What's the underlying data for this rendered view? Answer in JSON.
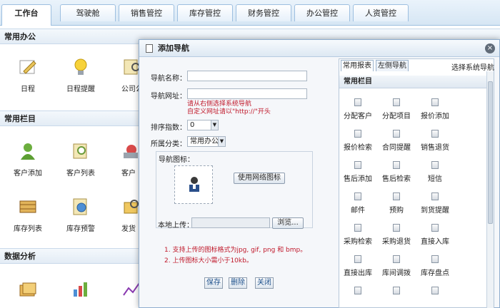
{
  "top_tabs": [
    "工作台",
    "驾驶舱",
    "销售管控",
    "库存管控",
    "财务管控",
    "办公管控",
    "人资管控"
  ],
  "sections": [
    {
      "title": "常用办公",
      "apps": [
        {
          "label": "日程",
          "icon": "calendar-pen-icon"
        },
        {
          "label": "日程提醒",
          "icon": "lightbulb-icon"
        },
        {
          "label": "公司公",
          "icon": "search-doc-icon"
        }
      ]
    },
    {
      "title": "常用栏目",
      "apps": [
        {
          "label": "客户添加",
          "icon": "user-add-icon"
        },
        {
          "label": "客户列表",
          "icon": "user-search-icon"
        },
        {
          "label": "客户",
          "icon": "user-remove-icon"
        }
      ]
    },
    {
      "row3": [
        {
          "label": "库存列表",
          "icon": "abacus-icon"
        },
        {
          "label": "库存预警",
          "icon": "clock-doc-icon"
        },
        {
          "label": "发货",
          "icon": "search-folder-icon"
        }
      ]
    },
    {
      "title": "数据分析",
      "apps": [
        {
          "icon": "folders-icon"
        },
        {
          "icon": "bar-chart-icon"
        },
        {
          "icon": "line-chart-icon"
        }
      ]
    }
  ],
  "modal": {
    "title": "添加导航",
    "close": "×",
    "name_label": "导航名称：",
    "url_label": "导航网址：",
    "hint1": "请从右侧选择系统导航",
    "hint2": "自定义网址请以\"http://\"开头",
    "sort_label": "排序指数：",
    "sort_value": "0",
    "category_label": "所属分类：",
    "category_value": "常用办公",
    "icon_legend": "导航图标：",
    "use_web_icon": "使用网络图标",
    "local_upload_label": "本地上传：",
    "browse": "浏览...",
    "notes": [
      "1.  支持上传的图标格式为jpg, gif, png 和 bmp。",
      "2.  上传图标大小需小于10kb。"
    ],
    "save": "保存",
    "delete": "删除",
    "close_btn": "关闭"
  },
  "right_panel": {
    "tabs": [
      "常用报表",
      "左侧导航"
    ],
    "select_system_nav": "选择系统导航",
    "header": "常用栏目",
    "items": [
      "分配客户",
      "分配项目",
      "报价添加",
      "报价检索",
      "合同提醒",
      "销售退货",
      "售后添加",
      "售后检索",
      "短信",
      "邮件",
      "预购",
      "到货提醒",
      "采购检索",
      "采购退货",
      "直接入库",
      "直接出库",
      "库间调拨",
      "库存盘点",
      "",
      "",
      ""
    ]
  },
  "colors": {
    "accent_red": "#c0182a",
    "tab_border": "#9dbfe0",
    "link_blue": "#1a4e8a"
  }
}
